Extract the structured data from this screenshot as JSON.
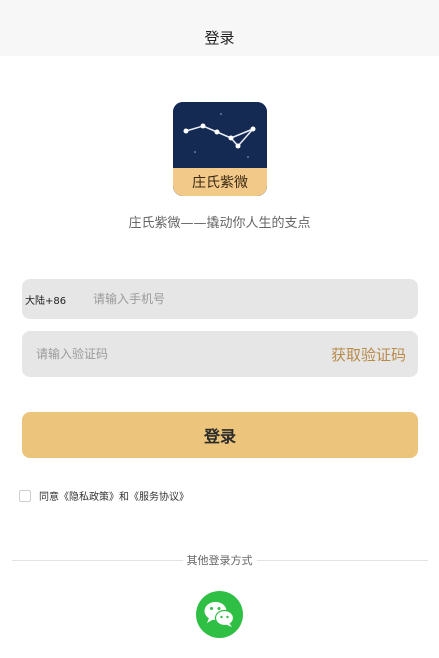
{
  "header": {
    "title": "登录"
  },
  "app": {
    "icon_name": "constellation-icon",
    "icon_label": "庄氏紫微",
    "tagline": "庄氏紫微——撬动你人生的支点"
  },
  "phone": {
    "region": "大陆+86",
    "placeholder": "请输入手机号"
  },
  "code": {
    "placeholder": "请输入验证码",
    "get_code_label": "获取验证码"
  },
  "login_button": {
    "label": "登录"
  },
  "agreement": {
    "text": "同意《隐私政策》和《服务协议》",
    "checked": false
  },
  "other_login": {
    "label": "其他登录方式",
    "providers": [
      {
        "name": "wechat-icon"
      }
    ]
  },
  "colors": {
    "accent": "#ecc47c",
    "link": "#b88b4a",
    "wechat": "#2fbf45"
  }
}
